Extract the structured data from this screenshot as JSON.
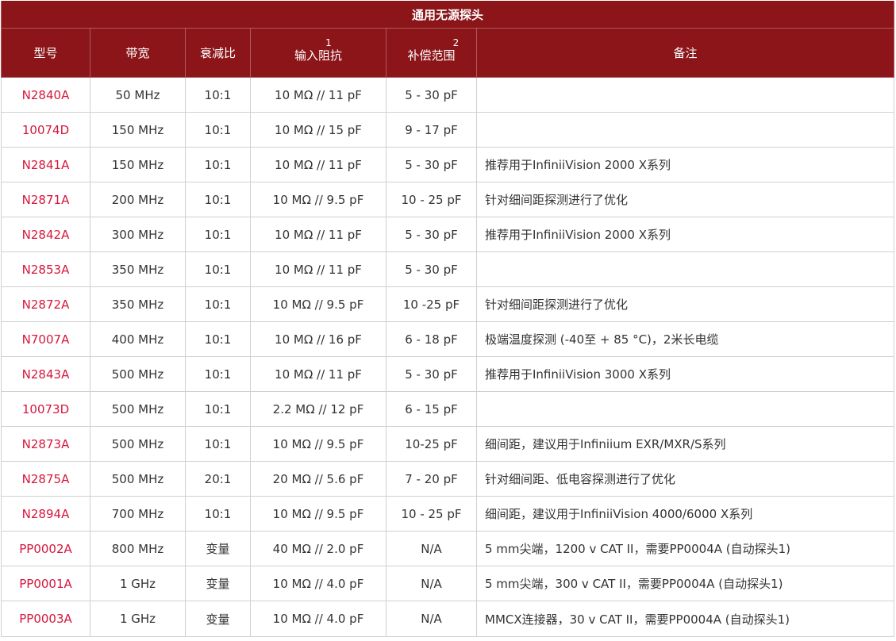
{
  "table": {
    "title": "通用无源探头",
    "headers": {
      "model": "型号",
      "bandwidth": "带宽",
      "attenuation": "衰减比",
      "input_impedance": "输入阻抗",
      "input_impedance_sup": "1",
      "compensation": "补偿范围",
      "compensation_sup": "2",
      "notes": "备注"
    },
    "rows": [
      {
        "model": "N2840A",
        "bandwidth": "50 MHz",
        "attenuation": "10:1",
        "impedance": "10 MΩ // 11 pF",
        "compensation": "5 - 30 pF",
        "notes": ""
      },
      {
        "model": "10074D",
        "bandwidth": "150 MHz",
        "attenuation": "10:1",
        "impedance": "10 MΩ // 15 pF",
        "compensation": "9 - 17 pF",
        "notes": ""
      },
      {
        "model": "N2841A",
        "bandwidth": "150 MHz",
        "attenuation": "10:1",
        "impedance": "10 MΩ // 11 pF",
        "compensation": "5 - 30 pF",
        "notes": "推荐用于InfiniiVision 2000 X系列"
      },
      {
        "model": "N2871A",
        "bandwidth": "200 MHz",
        "attenuation": "10:1",
        "impedance": "10 MΩ // 9.5 pF",
        "compensation": "10 - 25 pF",
        "notes": "针对细间距探测进行了优化"
      },
      {
        "model": "N2842A",
        "bandwidth": "300 MHz",
        "attenuation": "10:1",
        "impedance": "10 MΩ // 11 pF",
        "compensation": "5 - 30 pF",
        "notes": "推荐用于InfiniiVision 2000 X系列"
      },
      {
        "model": "N2853A",
        "bandwidth": "350 MHz",
        "attenuation": "10:1",
        "impedance": "10 MΩ // 11 pF",
        "compensation": "5 - 30 pF",
        "notes": ""
      },
      {
        "model": "N2872A",
        "bandwidth": "350 MHz",
        "attenuation": "10:1",
        "impedance": "10 MΩ // 9.5 pF",
        "compensation": "10 -25 pF",
        "notes": "针对细间距探测进行了优化"
      },
      {
        "model": "N7007A",
        "bandwidth": "400 MHz",
        "attenuation": "10:1",
        "impedance": "10 MΩ // 16 pF",
        "compensation": "6 - 18 pF",
        "notes": "极端温度探测 (-40至 + 85 °C)，2米长电缆"
      },
      {
        "model": "N2843A",
        "bandwidth": "500 MHz",
        "attenuation": "10:1",
        "impedance": "10 MΩ // 11 pF",
        "compensation": "5 - 30 pF",
        "notes": "推荐用于InfiniiVision 3000 X系列"
      },
      {
        "model": "10073D",
        "bandwidth": "500 MHz",
        "attenuation": "10:1",
        "impedance": "2.2 MΩ // 12 pF",
        "compensation": "6 - 15 pF",
        "notes": ""
      },
      {
        "model": "N2873A",
        "bandwidth": "500 MHz",
        "attenuation": "10:1",
        "impedance": "10 MΩ // 9.5 pF",
        "compensation": "10-25 pF",
        "notes": "细间距，建议用于Infiniium EXR/MXR/S系列"
      },
      {
        "model": "N2875A",
        "bandwidth": "500 MHz",
        "attenuation": "20:1",
        "impedance": "20 MΩ // 5.6 pF",
        "compensation": "7 - 20 pF",
        "notes": "针对细间距、低电容探测进行了优化"
      },
      {
        "model": "N2894A",
        "bandwidth": "700 MHz",
        "attenuation": "10:1",
        "impedance": "10 MΩ // 9.5 pF",
        "compensation": "10 - 25 pF",
        "notes": "细间距，建议用于InfiniiVision 4000/6000 X系列"
      },
      {
        "model": "PP0002A",
        "bandwidth": "800 MHz",
        "attenuation": "变量",
        "impedance": "40 MΩ // 2.0 pF",
        "compensation": "N/A",
        "notes": "5 mm尖端，1200 v CAT II，需要PP0004A (自动探头1)"
      },
      {
        "model": "PP0001A",
        "bandwidth": "1 GHz",
        "attenuation": "变量",
        "impedance": "10 MΩ // 4.0 pF",
        "compensation": "N/A",
        "notes": "5 mm尖端，300 v CAT II，需要PP0004A (自动探头1)"
      },
      {
        "model": "PP0003A",
        "bandwidth": "1 GHz",
        "attenuation": "变量",
        "impedance": "10 MΩ // 4.0 pF",
        "compensation": "N/A",
        "notes": "MMCX连接器，30 v CAT II，需要PP0004A (自动探头1)"
      }
    ]
  },
  "colors": {
    "header_background": "#8b1519",
    "header_text": "#ffffff",
    "model_link": "#d6163b",
    "body_text": "#333333",
    "grid_line": "#d0d0d0"
  }
}
